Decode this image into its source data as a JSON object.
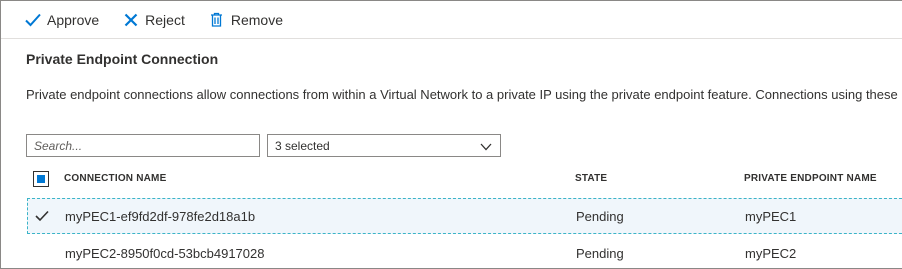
{
  "toolbar": {
    "approve_label": "Approve",
    "reject_label": "Reject",
    "remove_label": "Remove"
  },
  "section": {
    "title": "Private Endpoint Connection",
    "description": "Private endpoint connections allow connections from within a Virtual Network to a private IP using the private endpoint feature. Connections using these"
  },
  "filters": {
    "search_placeholder": "Search...",
    "select_value": "3 selected"
  },
  "table": {
    "columns": [
      "CONNECTION NAME",
      "STATE",
      "PRIVATE ENDPOINT NAME"
    ],
    "rows": [
      {
        "name": "myPEC1-ef9fd2df-978fe2d18a1b",
        "state": "Pending",
        "endpoint": "myPEC1",
        "checked": true
      },
      {
        "name": "myPEC2-8950f0cd-53bcb4917028",
        "state": "Pending",
        "endpoint": "myPEC2",
        "checked": false
      }
    ]
  },
  "colors": {
    "accent": "#0078d4",
    "selection_border": "#3bb4c8"
  }
}
